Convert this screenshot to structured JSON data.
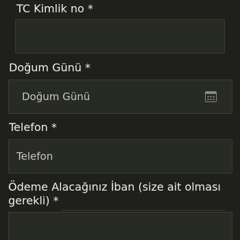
{
  "fields": {
    "tc": {
      "label": "TC Kimlik no *",
      "value": "",
      "placeholder": ""
    },
    "dob": {
      "label": "Doğum Günü *",
      "value": "",
      "placeholder": "Doğum Günü",
      "icon": "calendar-icon"
    },
    "phone": {
      "label": "Telefon *",
      "value": "",
      "placeholder": "Telefon"
    },
    "iban": {
      "label": "Ödeme Alacağınız İban (size ait olması gerekli) *",
      "value": "",
      "placeholder": ""
    }
  }
}
